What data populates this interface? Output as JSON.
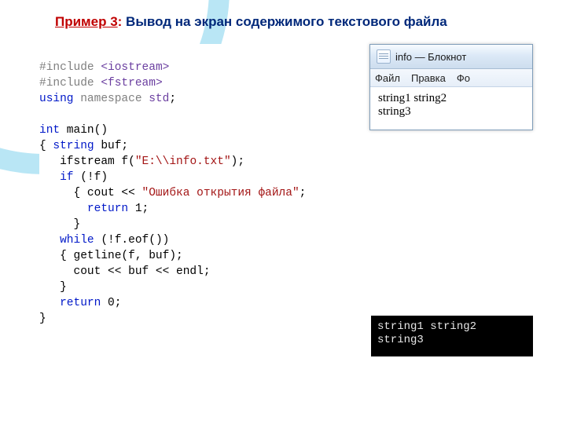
{
  "title": {
    "example": "Пример 3",
    "separator": ": ",
    "text": "Вывод на экран содержимого текстового файла"
  },
  "code": {
    "include1_a": "#include ",
    "include1_b": "<iostream>",
    "include2_a": "#include ",
    "include2_b": "<fstream>",
    "using_a": "using",
    "using_b": " namespace ",
    "using_c": "std",
    "using_d": ";",
    "int": "int",
    "main": " main()",
    "lbrace": "{ ",
    "string_kw": "string",
    "buf": " buf;",
    "ifstream_a": "   ifstream f(",
    "ifstream_b": "\"E:\\\\info.txt\"",
    "ifstream_c": ");",
    "if_a": "   ",
    "if_b": "if",
    "if_c": " (!f)",
    "cout1_a": "     { cout << ",
    "cout1_b": "\"Ошибка открытия файла\"",
    "cout1_c": ";",
    "return1_a": "       ",
    "return1_b": "return",
    "return1_c": " 1;",
    "rbrace1": "     }",
    "while_a": "   ",
    "while_b": "while",
    "while_c": " (!f.eof())",
    "getline": "   { getline(f, buf);",
    "cout2": "     cout << buf << endl;",
    "rbrace2": "   }",
    "return0_a": "   ",
    "return0_b": "return",
    "return0_c": " 0;",
    "rbrace3": "}"
  },
  "notepad": {
    "title": "info — Блокнот",
    "menu": {
      "file": "Файл",
      "edit": "Правка",
      "format": "Фо"
    },
    "content": "string1 string2\nstring3"
  },
  "console": {
    "content": "string1 string2\nstring3"
  }
}
